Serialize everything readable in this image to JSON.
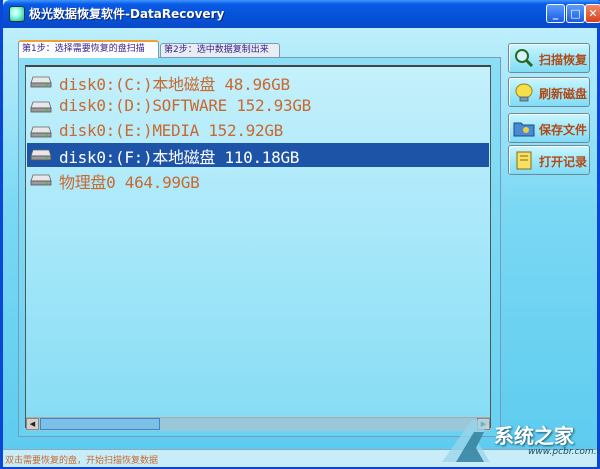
{
  "window": {
    "title": "极光数据恢复软件-DataRecovery",
    "minimize_glyph": "_",
    "maximize_glyph": "□",
    "close_glyph": "✕"
  },
  "tabs": [
    {
      "label": "第1步：选择需要恢复的盘扫描",
      "active": true
    },
    {
      "label": "第2步：选中数据复制出来",
      "active": false
    }
  ],
  "disks": [
    {
      "label": "disk0:(C:)本地磁盘 48.96GB",
      "selected": false,
      "icon": "hard-drive-icon"
    },
    {
      "label": "disk0:(D:)SOFTWARE 152.93GB",
      "selected": false,
      "icon": "hard-drive-icon"
    },
    {
      "label": "disk0:(E:)MEDIA 152.92GB",
      "selected": false,
      "icon": "hard-drive-icon"
    },
    {
      "label": "disk0:(F:)本地磁盘 110.18GB",
      "selected": true,
      "icon": "hard-drive-icon"
    },
    {
      "label": "物理盘0 464.99GB",
      "selected": false,
      "icon": "hard-drive-icon"
    }
  ],
  "actions": {
    "scan": {
      "label": "扫描恢复",
      "icon": "magnifier-icon"
    },
    "refresh": {
      "label": "刷新磁盘",
      "icon": "lightbulb-icon"
    },
    "save": {
      "label": "保存文件",
      "icon": "folder-icon"
    },
    "open_log": {
      "label": "打开记录",
      "icon": "notebook-icon"
    }
  },
  "status": {
    "text": "双击需要恢复的盘，开始扫描恢复数据"
  },
  "watermark": {
    "text": "系统之家",
    "url": "www.pcbr.com.cn"
  },
  "colors": {
    "selection": "#1d54a8",
    "item_text": "#c86a30",
    "button_text": "#b04a18",
    "titlebar": "#0552d8"
  }
}
